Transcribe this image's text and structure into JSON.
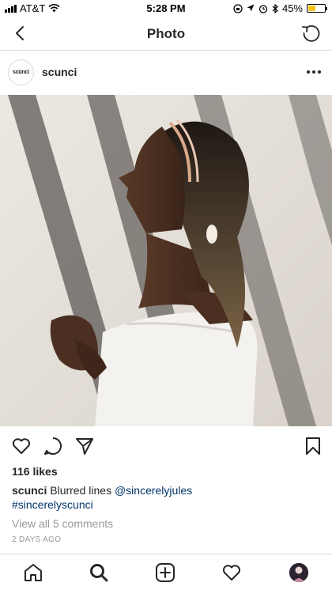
{
  "status_bar": {
    "carrier": "AT&T",
    "time": "5:28 PM",
    "battery_percent": "45%",
    "battery_level": 0.45,
    "icons": [
      "wifi-icon",
      "rotation-lock-icon",
      "location-icon",
      "alarm-icon",
      "bluetooth-icon"
    ]
  },
  "nav": {
    "title": "Photo",
    "back_icon": "chevron-left-icon",
    "refresh_icon": "refresh-icon"
  },
  "post": {
    "avatar_text": "scünci",
    "username": "scunci",
    "more_icon": "more-horizontal-icon",
    "likes": "116 likes",
    "caption_user": "scunci",
    "caption_text": "Blurred lines",
    "mention": "@sincerelyjules",
    "hashtag": "#sincerelyscunci",
    "view_comments": "View all 5 comments",
    "timestamp": "2 DAYS AGO"
  },
  "actions": [
    "heart-icon",
    "comment-icon",
    "share-icon",
    "bookmark-icon"
  ],
  "tabbar": [
    "home-icon",
    "search-icon",
    "add-icon",
    "activity-icon",
    "profile-avatar"
  ],
  "colors": {
    "text": "#262626",
    "muted": "#999999",
    "link": "#003569",
    "border": "#dbdbdb",
    "battery": "#f5c518"
  }
}
